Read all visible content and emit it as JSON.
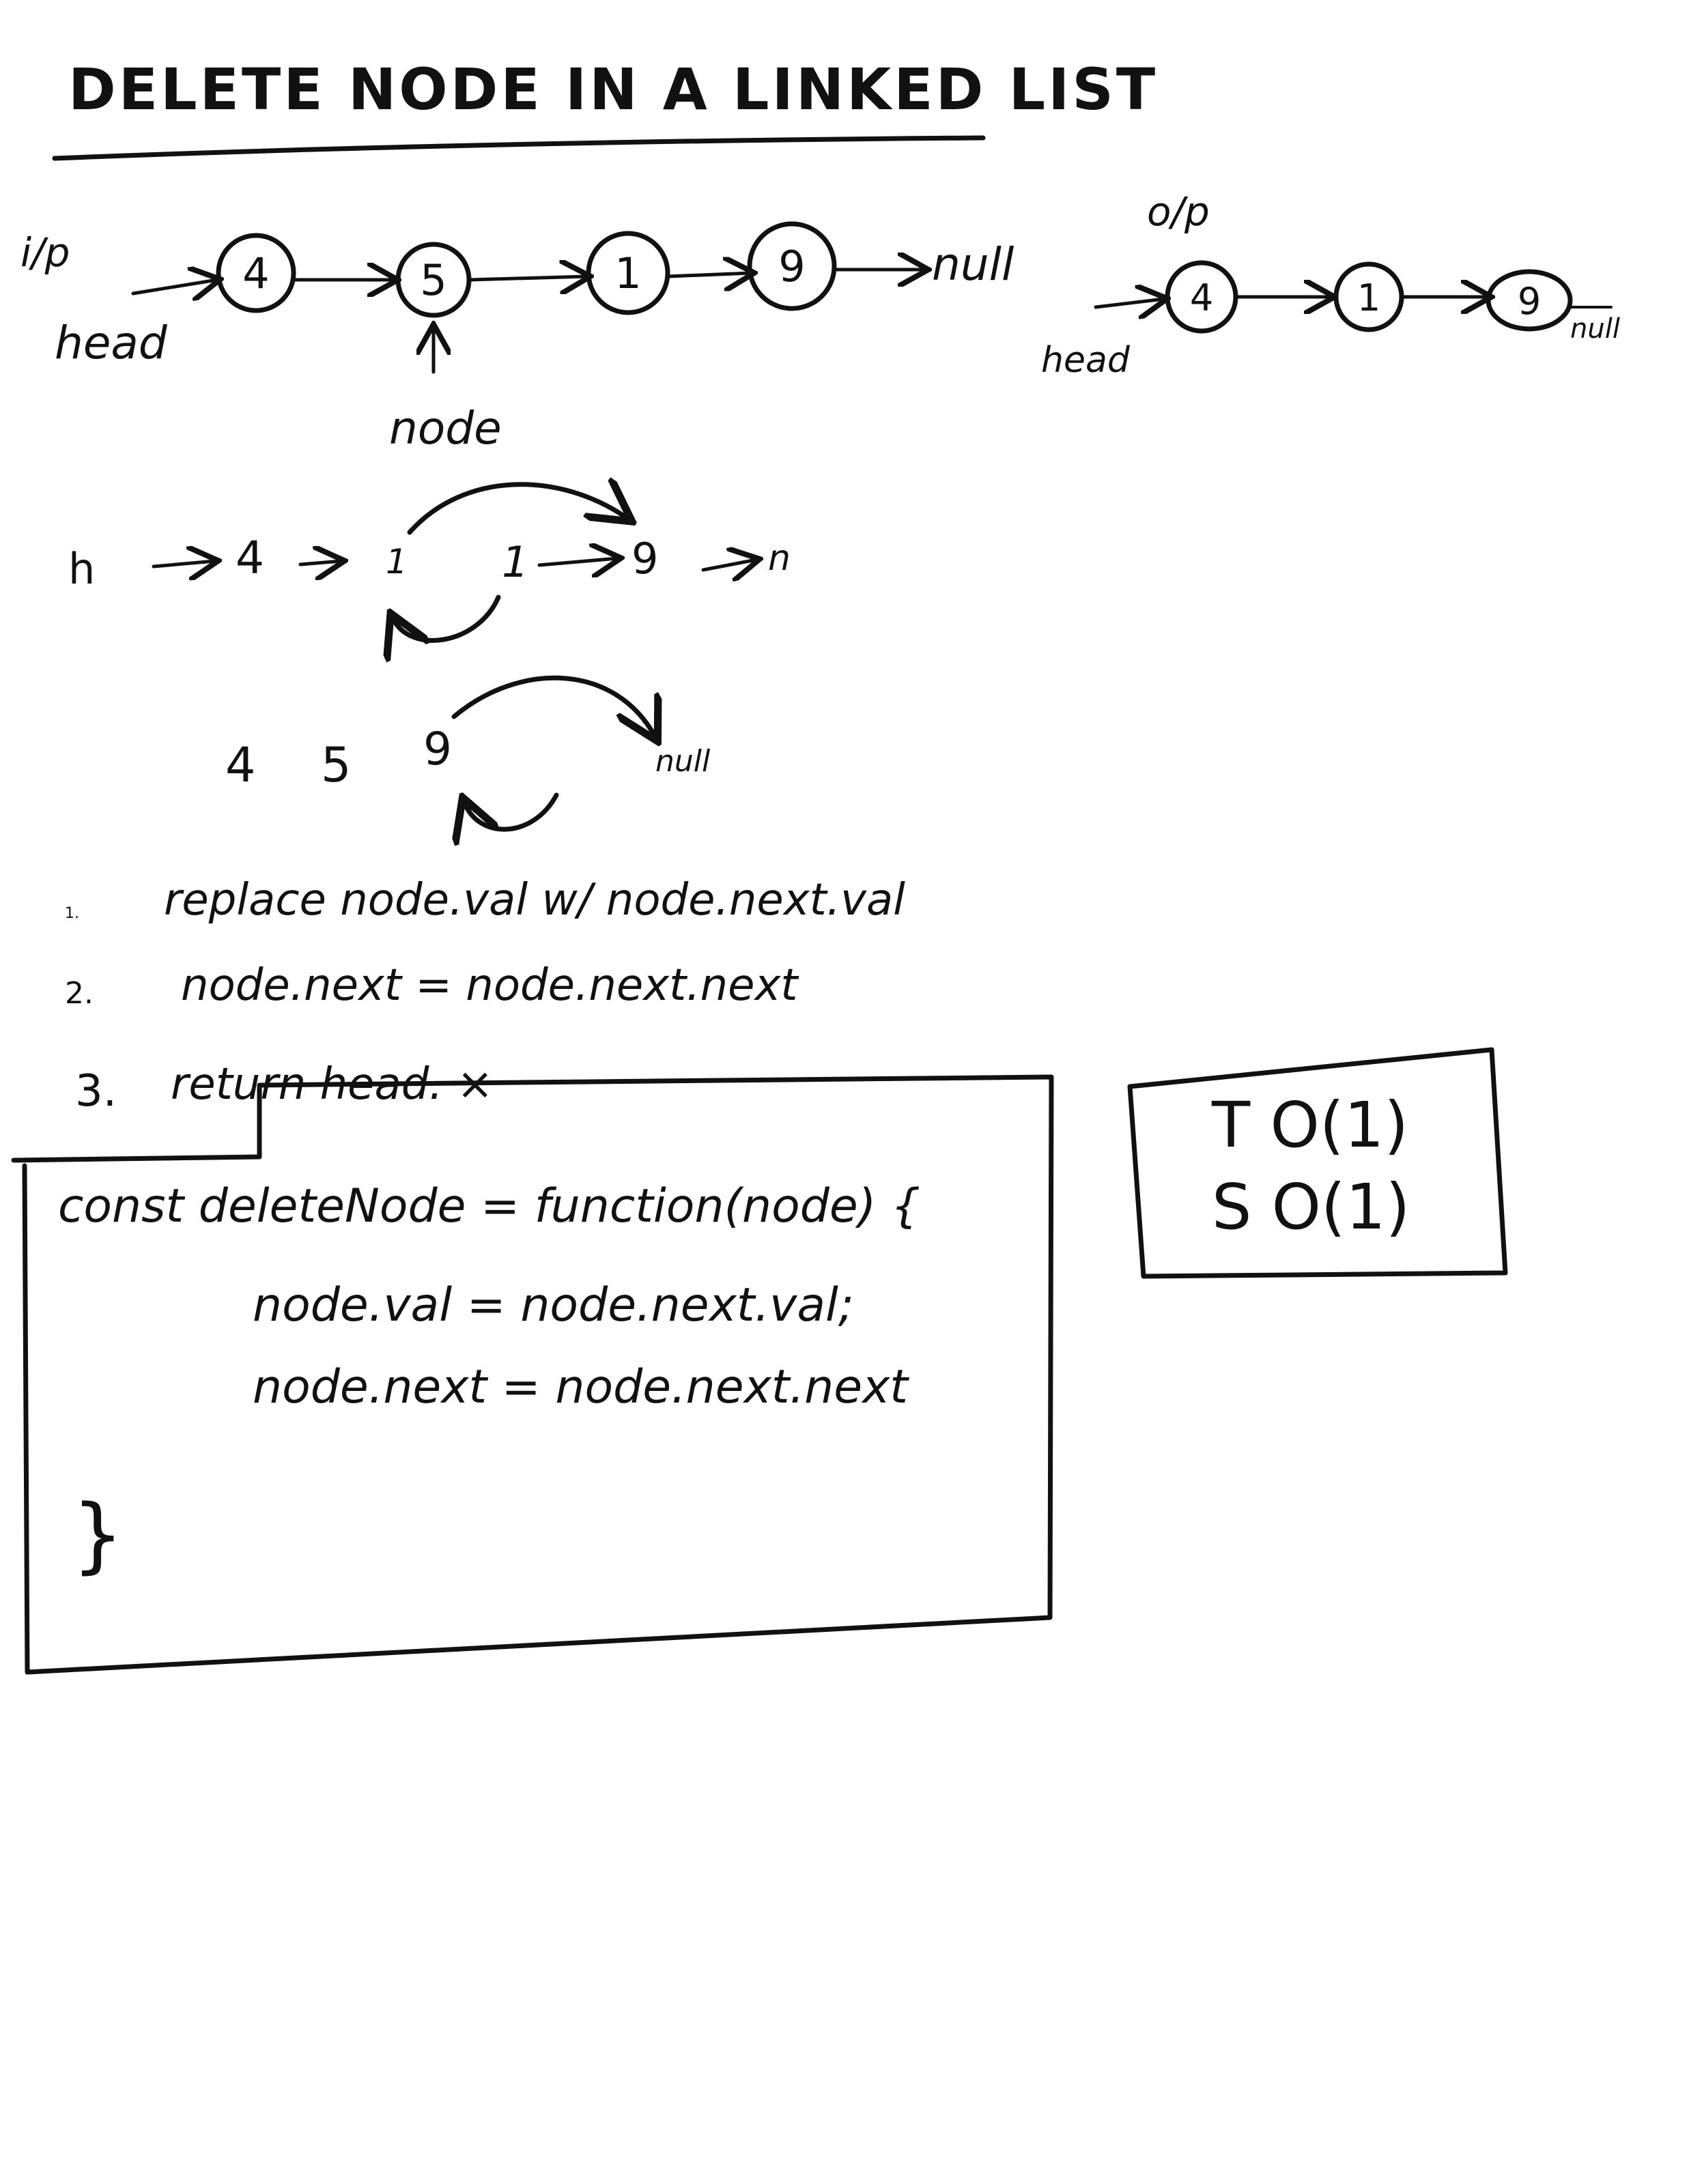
{
  "title": "DELETE NODE IN A LINKED LIST",
  "input_diagram": {
    "io_label": "i/p",
    "head_label": "head",
    "nodes": [
      "4",
      "5",
      "1",
      "9"
    ],
    "null_label": "null",
    "pointer_label": "node"
  },
  "output_diagram": {
    "io_label": "o/p",
    "head_label": "head",
    "nodes": [
      "4",
      "1",
      "9"
    ],
    "null_label": "null"
  },
  "sketch_1": {
    "items": [
      "h",
      "4",
      "1",
      "1",
      "9",
      "n"
    ]
  },
  "sketch_2": {
    "items": [
      "4",
      "5",
      "9",
      "null"
    ]
  },
  "steps": [
    {
      "number": "1.",
      "text": "replace node.val w/ node.next.val"
    },
    {
      "number": "2.",
      "text": "node.next = node.next.next"
    },
    {
      "number": "3.",
      "text": "return head. ×"
    }
  ],
  "code": {
    "lines": [
      "const deleteNode = function(node) {",
      "node.val = node.next.val;",
      "node.next = node.next.next",
      "}"
    ]
  },
  "complexity": {
    "time": "T O(1)",
    "space": "S O(1)"
  }
}
